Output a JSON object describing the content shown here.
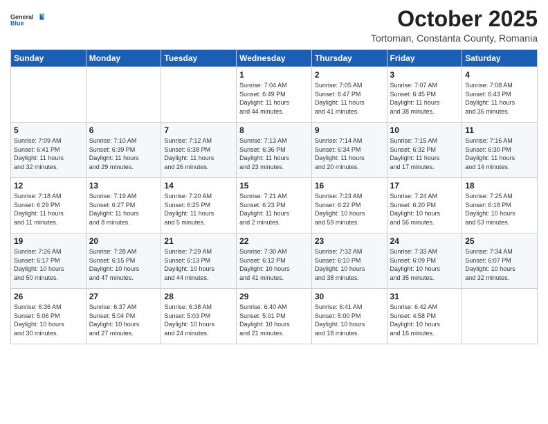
{
  "header": {
    "logo_general": "General",
    "logo_blue": "Blue",
    "month": "October 2025",
    "location": "Tortoman, Constanta County, Romania"
  },
  "days_of_week": [
    "Sunday",
    "Monday",
    "Tuesday",
    "Wednesday",
    "Thursday",
    "Friday",
    "Saturday"
  ],
  "weeks": [
    [
      {
        "day": "",
        "info": ""
      },
      {
        "day": "",
        "info": ""
      },
      {
        "day": "",
        "info": ""
      },
      {
        "day": "1",
        "info": "Sunrise: 7:04 AM\nSunset: 6:49 PM\nDaylight: 11 hours\nand 44 minutes."
      },
      {
        "day": "2",
        "info": "Sunrise: 7:05 AM\nSunset: 6:47 PM\nDaylight: 11 hours\nand 41 minutes."
      },
      {
        "day": "3",
        "info": "Sunrise: 7:07 AM\nSunset: 6:45 PM\nDaylight: 11 hours\nand 38 minutes."
      },
      {
        "day": "4",
        "info": "Sunrise: 7:08 AM\nSunset: 6:43 PM\nDaylight: 11 hours\nand 35 minutes."
      }
    ],
    [
      {
        "day": "5",
        "info": "Sunrise: 7:09 AM\nSunset: 6:41 PM\nDaylight: 11 hours\nand 32 minutes."
      },
      {
        "day": "6",
        "info": "Sunrise: 7:10 AM\nSunset: 6:39 PM\nDaylight: 11 hours\nand 29 minutes."
      },
      {
        "day": "7",
        "info": "Sunrise: 7:12 AM\nSunset: 6:38 PM\nDaylight: 11 hours\nand 26 minutes."
      },
      {
        "day": "8",
        "info": "Sunrise: 7:13 AM\nSunset: 6:36 PM\nDaylight: 11 hours\nand 23 minutes."
      },
      {
        "day": "9",
        "info": "Sunrise: 7:14 AM\nSunset: 6:34 PM\nDaylight: 11 hours\nand 20 minutes."
      },
      {
        "day": "10",
        "info": "Sunrise: 7:15 AM\nSunset: 6:32 PM\nDaylight: 11 hours\nand 17 minutes."
      },
      {
        "day": "11",
        "info": "Sunrise: 7:16 AM\nSunset: 6:30 PM\nDaylight: 11 hours\nand 14 minutes."
      }
    ],
    [
      {
        "day": "12",
        "info": "Sunrise: 7:18 AM\nSunset: 6:29 PM\nDaylight: 11 hours\nand 11 minutes."
      },
      {
        "day": "13",
        "info": "Sunrise: 7:19 AM\nSunset: 6:27 PM\nDaylight: 11 hours\nand 8 minutes."
      },
      {
        "day": "14",
        "info": "Sunrise: 7:20 AM\nSunset: 6:25 PM\nDaylight: 11 hours\nand 5 minutes."
      },
      {
        "day": "15",
        "info": "Sunrise: 7:21 AM\nSunset: 6:23 PM\nDaylight: 11 hours\nand 2 minutes."
      },
      {
        "day": "16",
        "info": "Sunrise: 7:23 AM\nSunset: 6:22 PM\nDaylight: 10 hours\nand 59 minutes."
      },
      {
        "day": "17",
        "info": "Sunrise: 7:24 AM\nSunset: 6:20 PM\nDaylight: 10 hours\nand 56 minutes."
      },
      {
        "day": "18",
        "info": "Sunrise: 7:25 AM\nSunset: 6:18 PM\nDaylight: 10 hours\nand 53 minutes."
      }
    ],
    [
      {
        "day": "19",
        "info": "Sunrise: 7:26 AM\nSunset: 6:17 PM\nDaylight: 10 hours\nand 50 minutes."
      },
      {
        "day": "20",
        "info": "Sunrise: 7:28 AM\nSunset: 6:15 PM\nDaylight: 10 hours\nand 47 minutes."
      },
      {
        "day": "21",
        "info": "Sunrise: 7:29 AM\nSunset: 6:13 PM\nDaylight: 10 hours\nand 44 minutes."
      },
      {
        "day": "22",
        "info": "Sunrise: 7:30 AM\nSunset: 6:12 PM\nDaylight: 10 hours\nand 41 minutes."
      },
      {
        "day": "23",
        "info": "Sunrise: 7:32 AM\nSunset: 6:10 PM\nDaylight: 10 hours\nand 38 minutes."
      },
      {
        "day": "24",
        "info": "Sunrise: 7:33 AM\nSunset: 6:09 PM\nDaylight: 10 hours\nand 35 minutes."
      },
      {
        "day": "25",
        "info": "Sunrise: 7:34 AM\nSunset: 6:07 PM\nDaylight: 10 hours\nand 32 minutes."
      }
    ],
    [
      {
        "day": "26",
        "info": "Sunrise: 6:36 AM\nSunset: 5:06 PM\nDaylight: 10 hours\nand 30 minutes."
      },
      {
        "day": "27",
        "info": "Sunrise: 6:37 AM\nSunset: 5:04 PM\nDaylight: 10 hours\nand 27 minutes."
      },
      {
        "day": "28",
        "info": "Sunrise: 6:38 AM\nSunset: 5:03 PM\nDaylight: 10 hours\nand 24 minutes."
      },
      {
        "day": "29",
        "info": "Sunrise: 6:40 AM\nSunset: 5:01 PM\nDaylight: 10 hours\nand 21 minutes."
      },
      {
        "day": "30",
        "info": "Sunrise: 6:41 AM\nSunset: 5:00 PM\nDaylight: 10 hours\nand 18 minutes."
      },
      {
        "day": "31",
        "info": "Sunrise: 6:42 AM\nSunset: 4:58 PM\nDaylight: 10 hours\nand 16 minutes."
      },
      {
        "day": "",
        "info": ""
      }
    ]
  ]
}
